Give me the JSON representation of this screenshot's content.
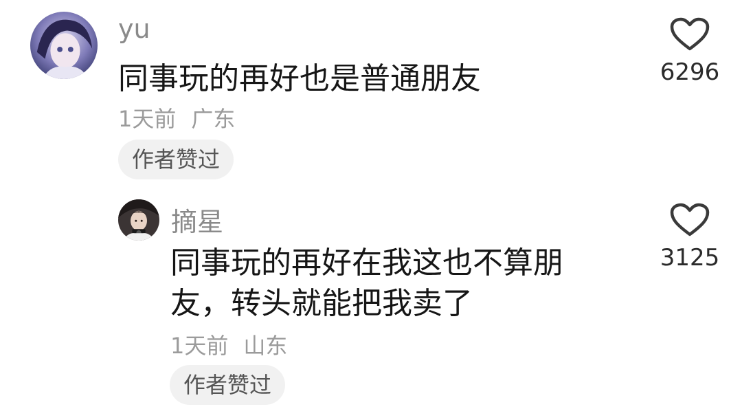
{
  "comments": [
    {
      "username": "yu",
      "text": "同事玩的再好也是普通朋友",
      "time": "1天前",
      "location": "广东",
      "badge": "作者赞过",
      "likes": "6296",
      "avatar": "anime-girl-avatar"
    },
    {
      "username": "摘星",
      "text": "同事玩的再好在我这也不算朋友，转头就能把我卖了",
      "time": "1天前",
      "location": "山东",
      "badge": "作者赞过",
      "likes": "3125",
      "avatar": "girl-photo-avatar"
    }
  ],
  "colors": {
    "username": "#8a8a8a",
    "text": "#161616",
    "meta": "#9b9b9b",
    "badge_bg": "#f1f1f1",
    "like_icon": "#3a3a3a"
  },
  "icons": {
    "like": "heart-outline-icon"
  }
}
